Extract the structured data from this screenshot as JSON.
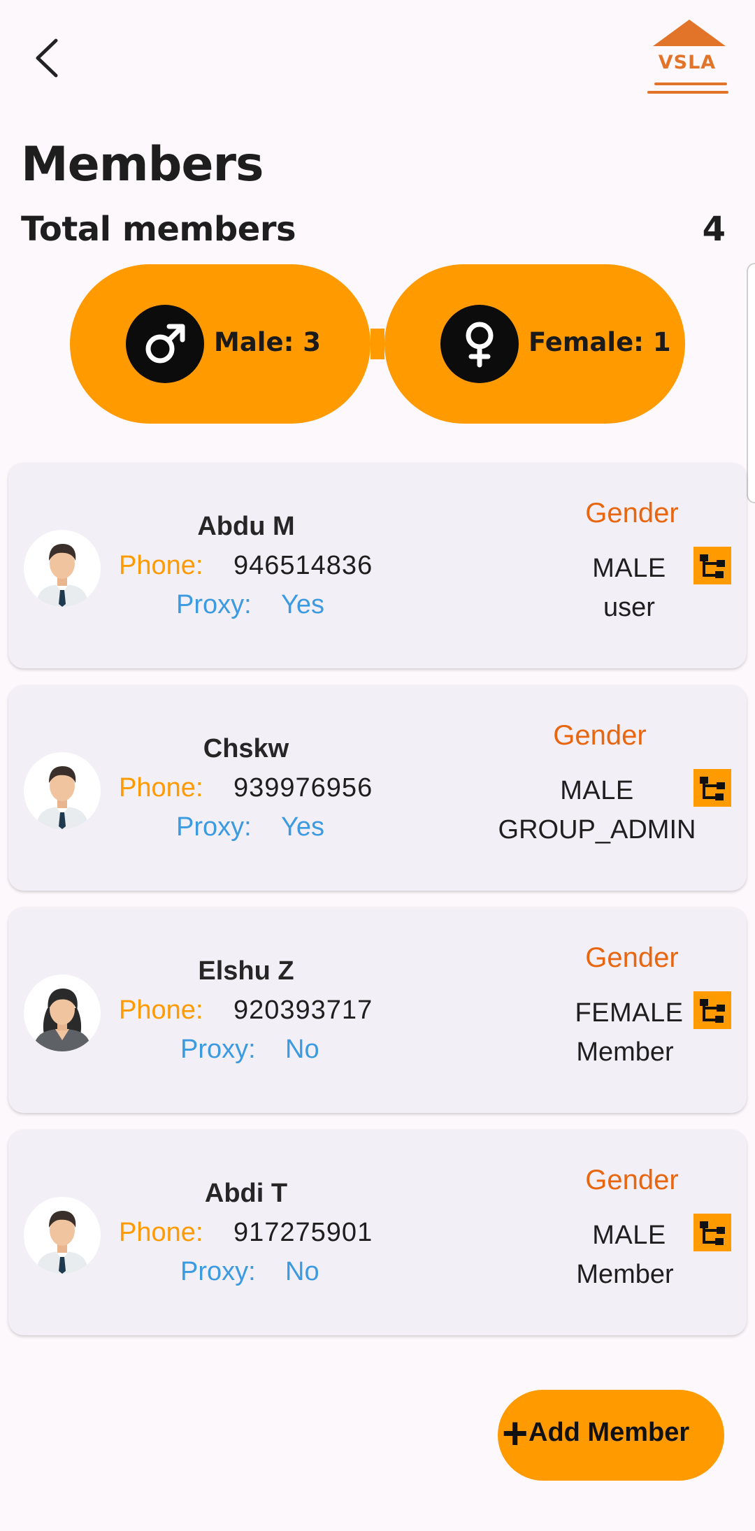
{
  "header": {
    "logo_text": "VSLA"
  },
  "page_title": "Members",
  "summary": {
    "total_label": "Total members",
    "total_value": "4",
    "male_label": "Male: 3",
    "female_label": "Female: 1"
  },
  "members": [
    {
      "name": "Abdu M",
      "phone_label": "Phone:",
      "phone": "946514836",
      "proxy_label": "Proxy:",
      "proxy": "Yes",
      "gender_label": "Gender",
      "gender": "MALE",
      "role": "user",
      "avatar": "male-avatar-icon"
    },
    {
      "name": "Chskw",
      "phone_label": "Phone:",
      "phone": "939976956",
      "proxy_label": "Proxy:",
      "proxy": "Yes",
      "gender_label": "Gender",
      "gender": "MALE",
      "role": "GROUP_ADMIN",
      "avatar": "male-avatar-icon"
    },
    {
      "name": "Elshu Z",
      "phone_label": "Phone:",
      "phone": "920393717",
      "proxy_label": "Proxy:",
      "proxy": "No",
      "gender_label": "Gender",
      "gender": "FEMALE",
      "role": "Member",
      "avatar": "female-avatar-icon"
    },
    {
      "name": "Abdi T",
      "phone_label": "Phone:",
      "phone": "917275901",
      "proxy_label": "Proxy:",
      "proxy": "No",
      "gender_label": "Gender",
      "gender": "MALE",
      "role": "Member",
      "avatar": "male-avatar-icon"
    }
  ],
  "add_member": {
    "plus": "+",
    "label": "Add Member"
  },
  "colors": {
    "accent": "#ff9a00",
    "brand": "#e2742a",
    "gender_label": "#e8660f",
    "proxy": "#3c9be0",
    "card_bg": "#f3eff7"
  }
}
